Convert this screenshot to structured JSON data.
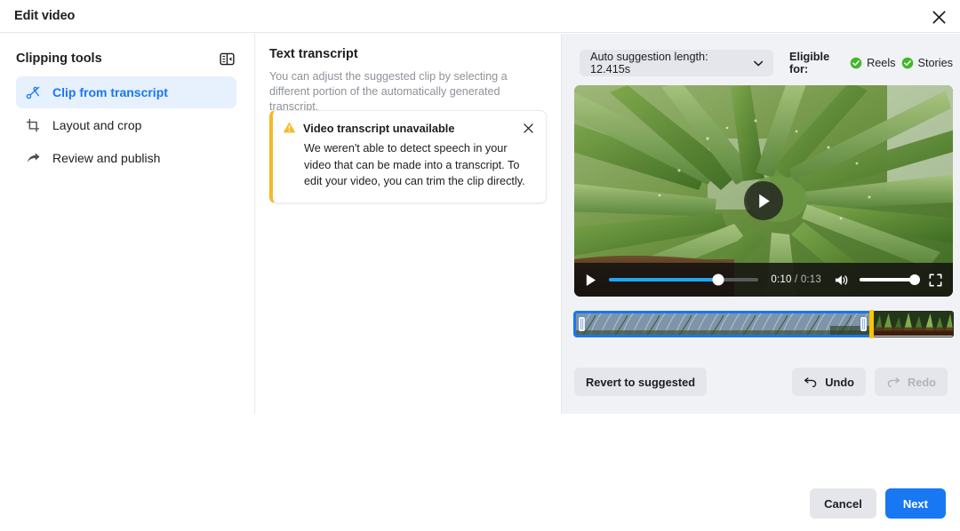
{
  "header": {
    "title": "Edit video",
    "close_icon": "close-icon"
  },
  "sidebar": {
    "title": "Clipping tools",
    "toggle_icon": "panel-collapse-icon",
    "items": [
      {
        "label": "Clip from transcript",
        "icon": "scissors-icon",
        "active": true
      },
      {
        "label": "Layout and crop",
        "icon": "crop-icon",
        "active": false
      },
      {
        "label": "Review and publish",
        "icon": "share-arrow-icon",
        "active": false
      }
    ]
  },
  "transcript": {
    "title": "Text transcript",
    "subtitle": "You can adjust the suggested clip by selecting a different portion of the automatically generated transcript.",
    "alert": {
      "icon": "warning-triangle-icon",
      "title": "Video transcript unavailable",
      "body": "We weren't able to detect speech in your video that can be made into a transcript. To edit your video, you can trim the clip directly.",
      "close_icon": "close-icon",
      "accent_color": "#f7b928"
    }
  },
  "preview": {
    "dropdown": {
      "label": "Auto suggestion length: 12.415s",
      "chevron_icon": "chevron-down-icon"
    },
    "eligibility": {
      "label": "Eligible for:",
      "items": [
        {
          "label": "Reels",
          "icon": "check-circle-icon",
          "color": "#42b72a"
        },
        {
          "label": "Stories",
          "icon": "check-circle-icon",
          "color": "#42b72a"
        }
      ]
    },
    "player": {
      "play_overlay_icon": "play-icon",
      "play_button_icon": "play-icon",
      "current_time": "0:10",
      "total_time": "0:13",
      "time_separator": "/",
      "progress_percent": 73,
      "volume_icon": "volume-on-icon",
      "volume_percent": 100,
      "fullscreen_icon": "fullscreen-icon"
    },
    "timeline": {
      "selection_handle_left": "trim-handle-left",
      "selection_handle_right": "trim-handle-right",
      "playhead_color": "#ffc400",
      "selection_color": "#1877f2"
    },
    "actions": {
      "revert_label": "Revert to suggested",
      "undo_label": "Undo",
      "undo_icon": "undo-icon",
      "redo_label": "Redo",
      "redo_icon": "redo-icon",
      "redo_disabled": true
    }
  },
  "footer": {
    "cancel_label": "Cancel",
    "next_label": "Next",
    "next_color": "#1877f2"
  }
}
